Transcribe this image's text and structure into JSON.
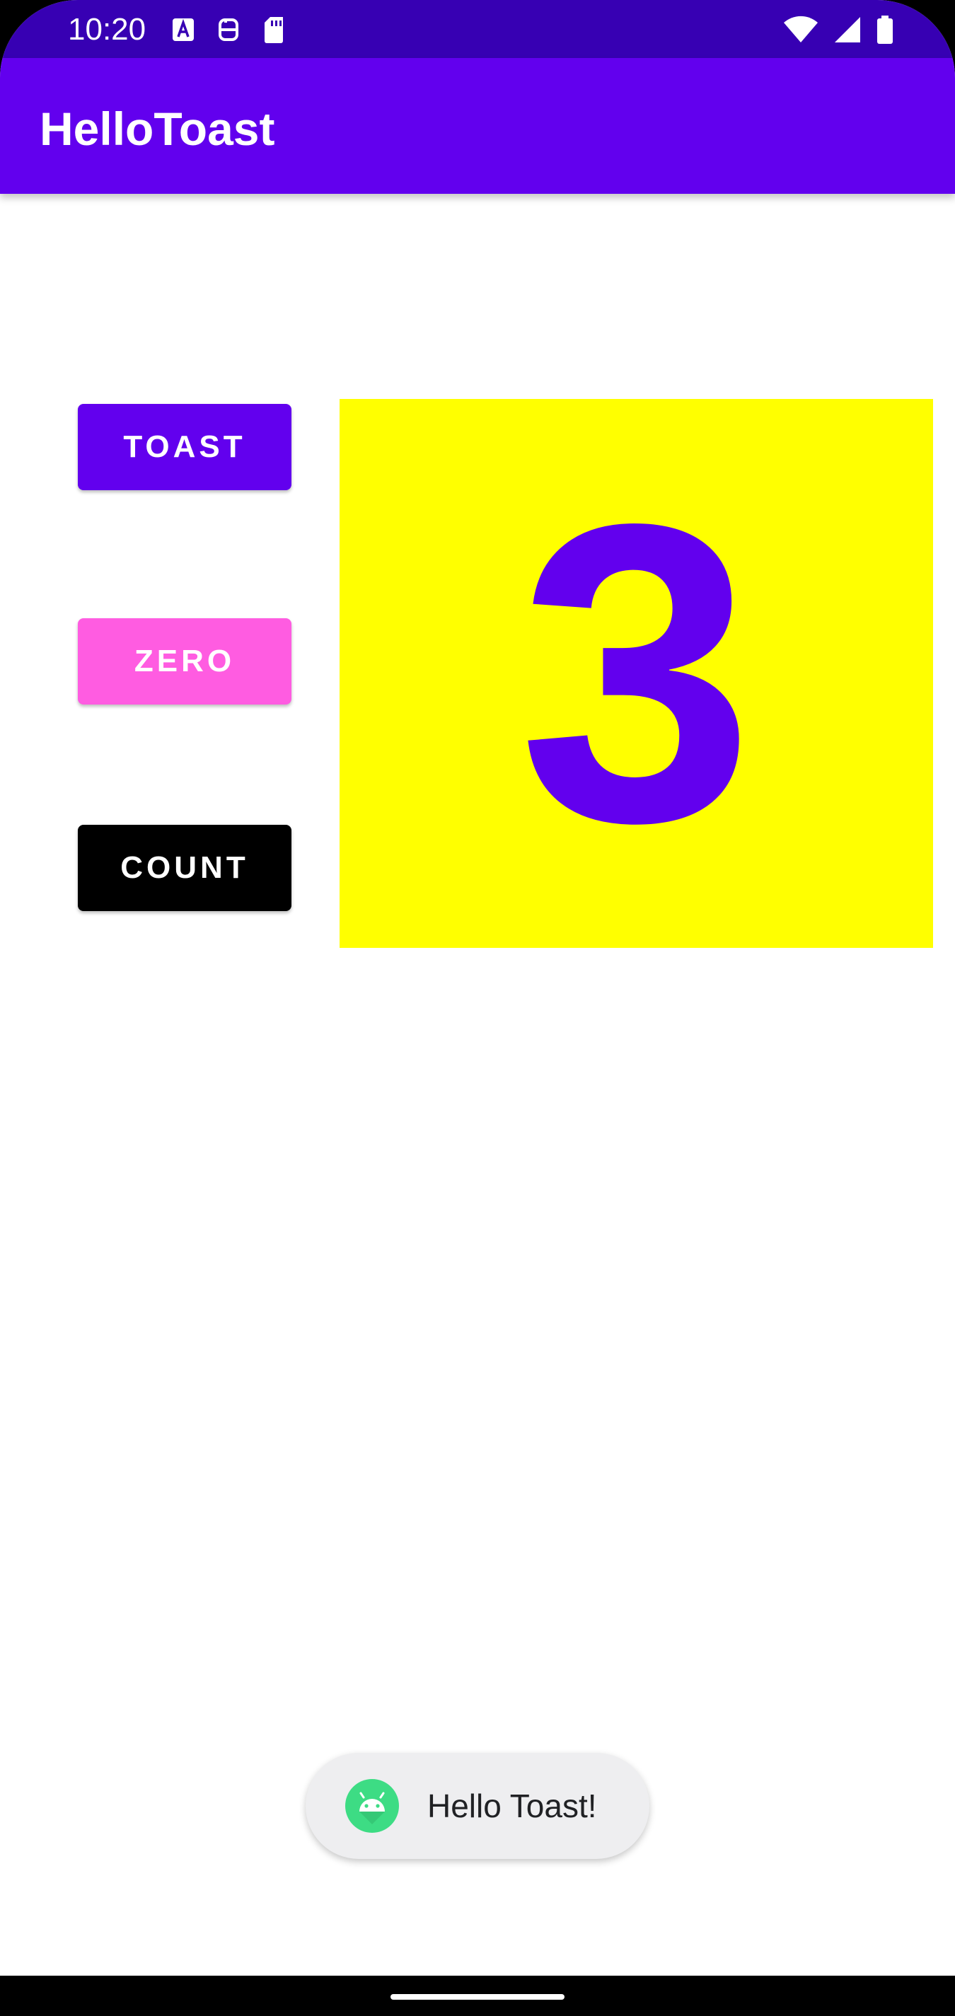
{
  "status_bar": {
    "time": "10:20",
    "left_icons": [
      "accessibility-a-icon",
      "sim-sync-icon",
      "sd-card-icon"
    ],
    "right_icons": [
      "wifi-icon",
      "cell-signal-icon",
      "battery-icon"
    ]
  },
  "app_bar": {
    "title": "HelloToast"
  },
  "buttons": {
    "toast": {
      "label": "TOAST",
      "color": "#6200ee"
    },
    "zero": {
      "label": "ZERO",
      "color": "#ff5ce1"
    },
    "count": {
      "label": "COUNT",
      "color": "#000000"
    }
  },
  "counter": {
    "value": "3",
    "background": "#ffff00",
    "text_color": "#6200ee"
  },
  "toast_message": {
    "text": "Hello Toast!",
    "icon": "android-icon"
  },
  "colors": {
    "status_bar": "#3700b3",
    "app_bar": "#6200ee"
  }
}
